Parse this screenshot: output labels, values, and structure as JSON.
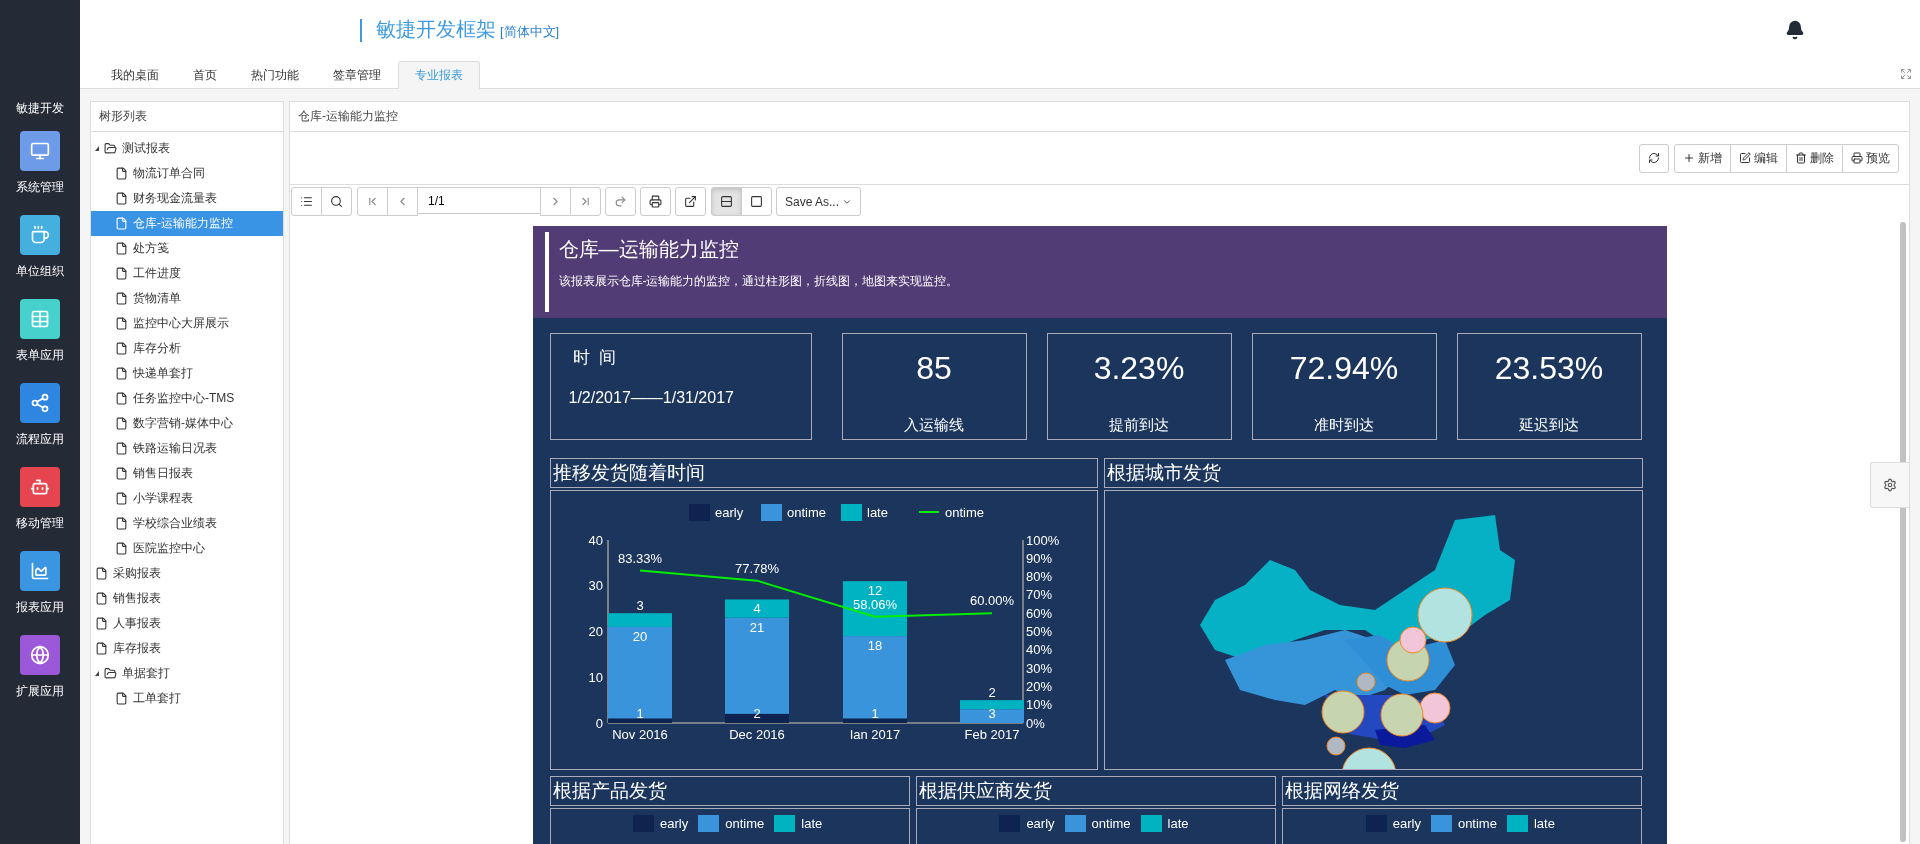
{
  "sidebar": {
    "brand": "敏捷开发",
    "items": [
      {
        "label": "系统管理",
        "color": "#6e9be8"
      },
      {
        "label": "单位组织",
        "color": "#45b0e0"
      },
      {
        "label": "表单应用",
        "color": "#46d1cc"
      },
      {
        "label": "流程应用",
        "color": "#2f86e0"
      },
      {
        "label": "移动管理",
        "color": "#e6444e"
      },
      {
        "label": "报表应用",
        "color": "#3a96e0"
      },
      {
        "label": "扩展应用",
        "color": "#9b59d9"
      }
    ]
  },
  "header": {
    "title": "敏捷开发框架",
    "language": "[简体中文]"
  },
  "tabs": [
    {
      "label": "我的桌面",
      "selected": false
    },
    {
      "label": "首页",
      "selected": false
    },
    {
      "label": "热门功能",
      "selected": false
    },
    {
      "label": "签章管理",
      "selected": false
    },
    {
      "label": "专业报表",
      "selected": true
    }
  ],
  "tree": {
    "title": "树形列表",
    "items": [
      {
        "label": "测试报表",
        "expanded": true,
        "selected": false,
        "children": [
          {
            "label": "物流订单合同",
            "selected": false
          },
          {
            "label": "财务现金流量表",
            "selected": false
          },
          {
            "label": "仓库-运输能力监控",
            "selected": true
          },
          {
            "label": "处方笺",
            "selected": false
          },
          {
            "label": "工件进度",
            "selected": false
          },
          {
            "label": "货物清单",
            "selected": false
          },
          {
            "label": "监控中心大屏展示",
            "selected": false
          },
          {
            "label": "库存分析",
            "selected": false
          },
          {
            "label": "快递单套打",
            "selected": false
          },
          {
            "label": "任务监控中心-TMS",
            "selected": false
          },
          {
            "label": "数字营销-媒体中心",
            "selected": false
          },
          {
            "label": "铁路运输日况表",
            "selected": false
          },
          {
            "label": "销售日报表",
            "selected": false
          },
          {
            "label": "小学课程表",
            "selected": false
          },
          {
            "label": "学校综合业绩表",
            "selected": false
          },
          {
            "label": "医院监控中心",
            "selected": false
          }
        ]
      },
      {
        "label": "采购报表",
        "selected": false
      },
      {
        "label": "销售报表",
        "selected": false
      },
      {
        "label": "人事报表",
        "selected": false
      },
      {
        "label": "库存报表",
        "selected": false
      },
      {
        "label": "单据套打",
        "expanded": true,
        "selected": false,
        "children": [
          {
            "label": "工单套打",
            "selected": false
          }
        ]
      }
    ]
  },
  "panel": {
    "title": "仓库-运输能力监控",
    "actions": [
      "新增",
      "编辑",
      "删除",
      "预览"
    ]
  },
  "viewer": {
    "page": "1/1",
    "view_modes": [
      {
        "selected": true
      },
      {
        "selected": false
      }
    ],
    "save_as": "Save As..."
  },
  "report": {
    "title": "仓库—运输能力监控",
    "description": "该报表展示仓库-运输能力的监控，通过柱形图，折线图，地图来实现监控。",
    "time_label": "时  间",
    "date_range": "1/2/2017——1/31/2017",
    "kpis": [
      {
        "value": "85",
        "label": "入运输线"
      },
      {
        "value": "3.23%",
        "label": "提前到达"
      },
      {
        "value": "72.94%",
        "label": "准时到达"
      },
      {
        "value": "23.53%",
        "label": "延迟到达"
      }
    ],
    "trend": {
      "title": "推移发货随着时间",
      "chart_data": {
        "type": "bar",
        "stacked": true,
        "categories": [
          "Nov 2016",
          "Dec 2016",
          "Ian 2017",
          "Feb 2017"
        ],
        "series": [
          {
            "name": "early",
            "color": "#0f2350",
            "values": [
              1,
              2,
              1,
              null
            ]
          },
          {
            "name": "ontime",
            "color": "#3a94dc",
            "values": [
              20,
              21,
              18,
              3
            ]
          },
          {
            "name": "late",
            "color": "#00b3c3",
            "values": [
              3,
              4,
              12,
              2
            ]
          },
          {
            "name": "ontime",
            "color": "#00ee00",
            "type": "line",
            "axis": "y2",
            "values": [
              83.33,
              77.78,
              58.06,
              60.0
            ],
            "value_labels": [
              "83.33%",
              "77.78%",
              "58.06%",
              "60.00%"
            ]
          }
        ],
        "legend": "top",
        "ylim": [
          0,
          40
        ],
        "yticks": [
          0,
          10,
          20,
          30,
          40
        ],
        "y2lim": [
          0,
          100
        ],
        "y2ticks": [
          {
            "value": 0,
            "label": "0%"
          },
          {
            "value": 10,
            "label": "10%"
          },
          {
            "value": 20,
            "label": "20%"
          },
          {
            "value": 30,
            "label": "30%"
          },
          {
            "value": 40,
            "label": "40%"
          },
          {
            "value": 50,
            "label": "50%"
          },
          {
            "value": 60,
            "label": "60%"
          },
          {
            "value": 70,
            "label": "70%"
          },
          {
            "value": 80,
            "label": "80%"
          },
          {
            "value": 90,
            "label": "90%"
          },
          {
            "value": 100,
            "label": "100%"
          }
        ],
        "data_labels": true
      }
    },
    "map": {
      "title": "根据城市发货",
      "kind": "picture"
    },
    "bottom_panels": [
      {
        "title": "根据产品发货",
        "legend": [
          {
            "label": "early",
            "color": "#0f2350"
          },
          {
            "label": "ontime",
            "color": "#3a94dc"
          },
          {
            "label": "late",
            "color": "#00b3c3"
          }
        ]
      },
      {
        "title": "根据供应商发货",
        "legend": [
          {
            "label": "early",
            "color": "#0f2350"
          },
          {
            "label": "ontime",
            "color": "#3a94dc"
          },
          {
            "label": "late",
            "color": "#00b3c3"
          }
        ]
      },
      {
        "title": "根据网络发货",
        "legend": [
          {
            "label": "early",
            "color": "#0f2350"
          },
          {
            "label": "ontime",
            "color": "#3a94dc"
          },
          {
            "label": "late",
            "color": "#00b3c3"
          }
        ]
      }
    ]
  }
}
